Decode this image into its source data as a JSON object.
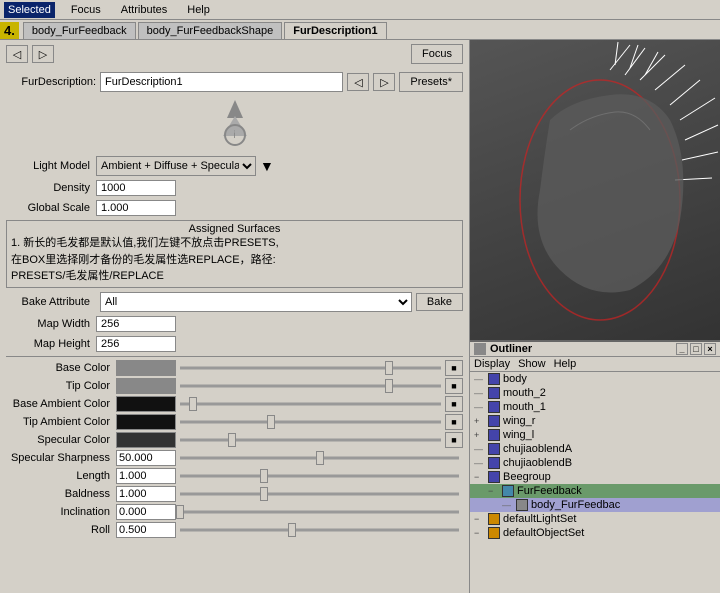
{
  "menu": {
    "items": [
      "Selected",
      "Focus",
      "Attributes",
      "Help"
    ]
  },
  "tab_number": "4.",
  "tabs": [
    {
      "label": "body_FurFeedback",
      "active": false
    },
    {
      "label": "body_FurFeedbackShape",
      "active": false
    },
    {
      "label": "FurDescription1",
      "active": true
    }
  ],
  "fur_desc": {
    "label": "FurDescription:",
    "value": "FurDescription1"
  },
  "buttons": {
    "focus": "Focus",
    "presets": "Presets*",
    "bake": "Bake"
  },
  "light_model": {
    "label": "Light Model",
    "value": "Ambient + Diffuse + Specular"
  },
  "density": {
    "label": "Density",
    "value": "1000"
  },
  "global_scale": {
    "label": "Global Scale",
    "value": "1.000"
  },
  "assigned_surfaces": {
    "title": "Assigned Surfaces",
    "content_line1": "1. 新长的毛发都是默认值,我们左键不放点击PRESETS,",
    "content_line2": "   在BOX里选择刚才备份的毛发属性选REPLACE，路径:",
    "content_line3": "   PRESETS/毛发属性/REPLACE"
  },
  "bake": {
    "label": "Bake Attribute",
    "option": "All"
  },
  "map_width": {
    "label": "Map Width",
    "value": "256"
  },
  "map_height": {
    "label": "Map Height",
    "value": "256"
  },
  "colors": {
    "base_color": {
      "label": "Base Color",
      "swatch": "#888888"
    },
    "tip_color": {
      "label": "Tip Color",
      "swatch": "#888888"
    },
    "base_ambient": {
      "label": "Base Ambient Color",
      "swatch": "#111111"
    },
    "tip_ambient": {
      "label": "Tip Ambient Color",
      "swatch": "#111111"
    },
    "specular": {
      "label": "Specular Color",
      "swatch": "#333333"
    }
  },
  "sliders": {
    "specular_sharpness": {
      "label": "Specular Sharpness",
      "value": "50.000",
      "thumb_pct": 50
    },
    "length": {
      "label": "Length",
      "value": "1.000",
      "thumb_pct": 30
    },
    "baldness": {
      "label": "Baldness",
      "value": "1.000",
      "thumb_pct": 30
    },
    "inclination": {
      "label": "Inclination",
      "value": "0.000",
      "thumb_pct": 0
    },
    "roll": {
      "label": "Roll",
      "value": "0.500",
      "thumb_pct": 50
    }
  },
  "outliner": {
    "title": "Outliner",
    "menus": [
      "Display",
      "Show",
      "Help"
    ],
    "items": [
      {
        "name": "body",
        "level": 0,
        "expanded": false,
        "color": "#4444aa"
      },
      {
        "name": "mouth_2",
        "level": 0,
        "expanded": false,
        "color": "#4444aa"
      },
      {
        "name": "mouth_1",
        "level": 0,
        "expanded": false,
        "color": "#4444aa"
      },
      {
        "name": "wing_r",
        "level": 0,
        "expanded": true,
        "color": "#4444aa"
      },
      {
        "name": "wing_l",
        "level": 0,
        "expanded": true,
        "color": "#4444aa"
      },
      {
        "name": "chujiaoblendA",
        "level": 0,
        "expanded": false,
        "color": "#4444aa"
      },
      {
        "name": "chujiaoblendB",
        "level": 0,
        "expanded": false,
        "color": "#4444aa"
      },
      {
        "name": "Beegroup",
        "level": 0,
        "expanded": true,
        "color": "#4444aa"
      },
      {
        "name": "FurFeedback",
        "level": 1,
        "expanded": true,
        "color": "#4488aa",
        "selected": false,
        "highlighted": true
      },
      {
        "name": "body_FurFeedbac",
        "level": 2,
        "expanded": false,
        "color": "#888888",
        "selected": true
      },
      {
        "name": "defaultLightSet",
        "level": 0,
        "expanded": false,
        "color": "#cc8800"
      },
      {
        "name": "defaultObjectSet",
        "level": 0,
        "expanded": false,
        "color": "#cc8800"
      }
    ]
  }
}
